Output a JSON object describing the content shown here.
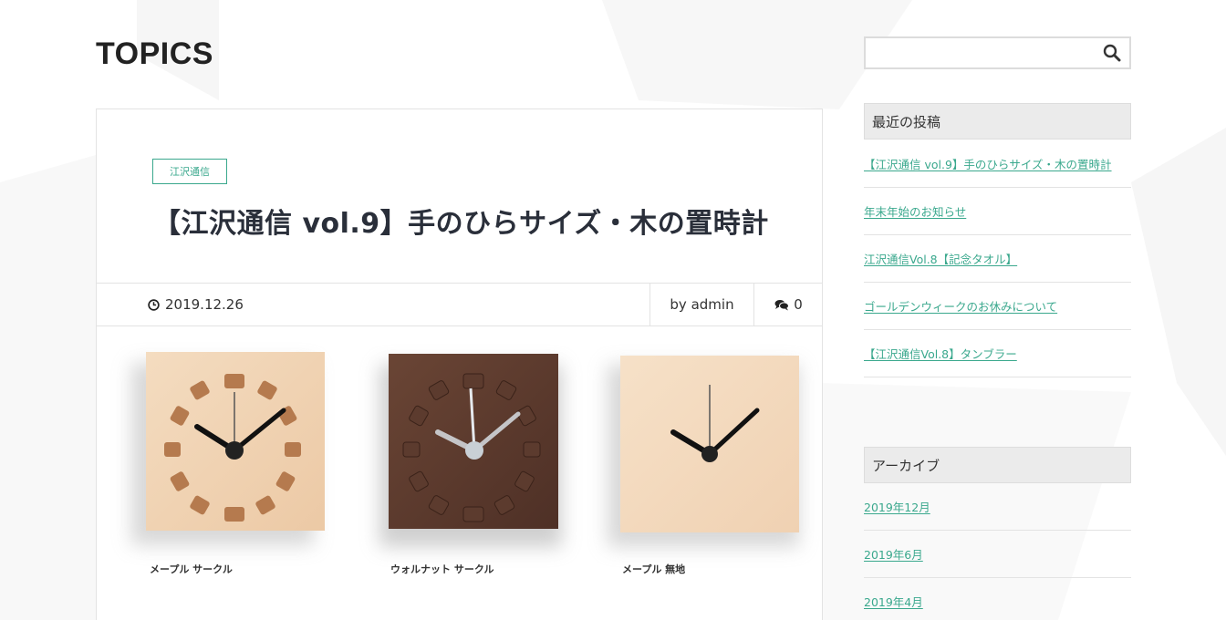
{
  "header": {
    "title": "TOPICS"
  },
  "article": {
    "category": "江沢通信",
    "title": "【江沢通信 vol.9】手のひらサイズ・木の置時計",
    "date": "2019.12.26",
    "author": "by admin",
    "comment_count": "0",
    "image": {
      "captions": [
        "メープル サークル",
        "ウォルナット サークル",
        "メープル 無地"
      ]
    }
  },
  "sidebar": {
    "search": {
      "placeholder": "",
      "value": ""
    },
    "recent": {
      "title": "最近の投稿",
      "items": [
        "【江沢通信 vol.9】手のひらサイズ・木の置時計",
        "年末年始のお知らせ",
        "江沢通信Vol.8【記念タオル】",
        "ゴールデンウィークのお休みについて",
        "【江沢通信Vol.8】タンブラー"
      ]
    },
    "archive": {
      "title": "アーカイブ",
      "items": [
        "2019年12月",
        "2019年6月",
        "2019年4月"
      ]
    }
  },
  "colors": {
    "accent": "#3aa88d",
    "text": "#333333",
    "widget_bg": "#ebebeb"
  },
  "icons": {
    "search": "search-icon",
    "date": "clock-icon",
    "comments": "comments-icon"
  }
}
